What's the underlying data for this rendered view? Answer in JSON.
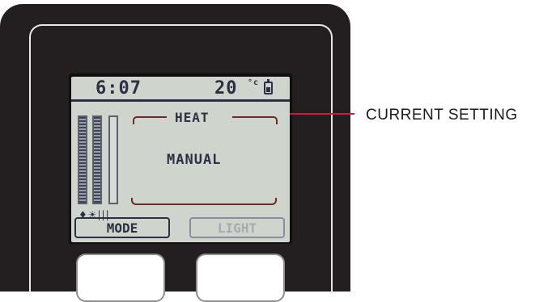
{
  "display": {
    "time": "6:07",
    "temperature": "20",
    "temperature_unit": "°c",
    "mode_title": "HEAT",
    "mode_value": "MANUAL",
    "level_bars_active": 2,
    "level_bars_total": 3,
    "status_icons": "♦☀|||"
  },
  "softkeys": {
    "left_label": "MODE",
    "right_label": "LIGHT"
  },
  "callout": {
    "label": "CURRENT SETTING"
  },
  "colors": {
    "device_body": "#231f20",
    "lcd_background": "#cfd5cd",
    "lcd_text": "#2b3042",
    "callout_line": "#d1183f"
  },
  "icons": {
    "battery": "battery-icon",
    "flame": "flame-icon",
    "sun": "sun-icon",
    "bars": "signal-bars-icon"
  }
}
